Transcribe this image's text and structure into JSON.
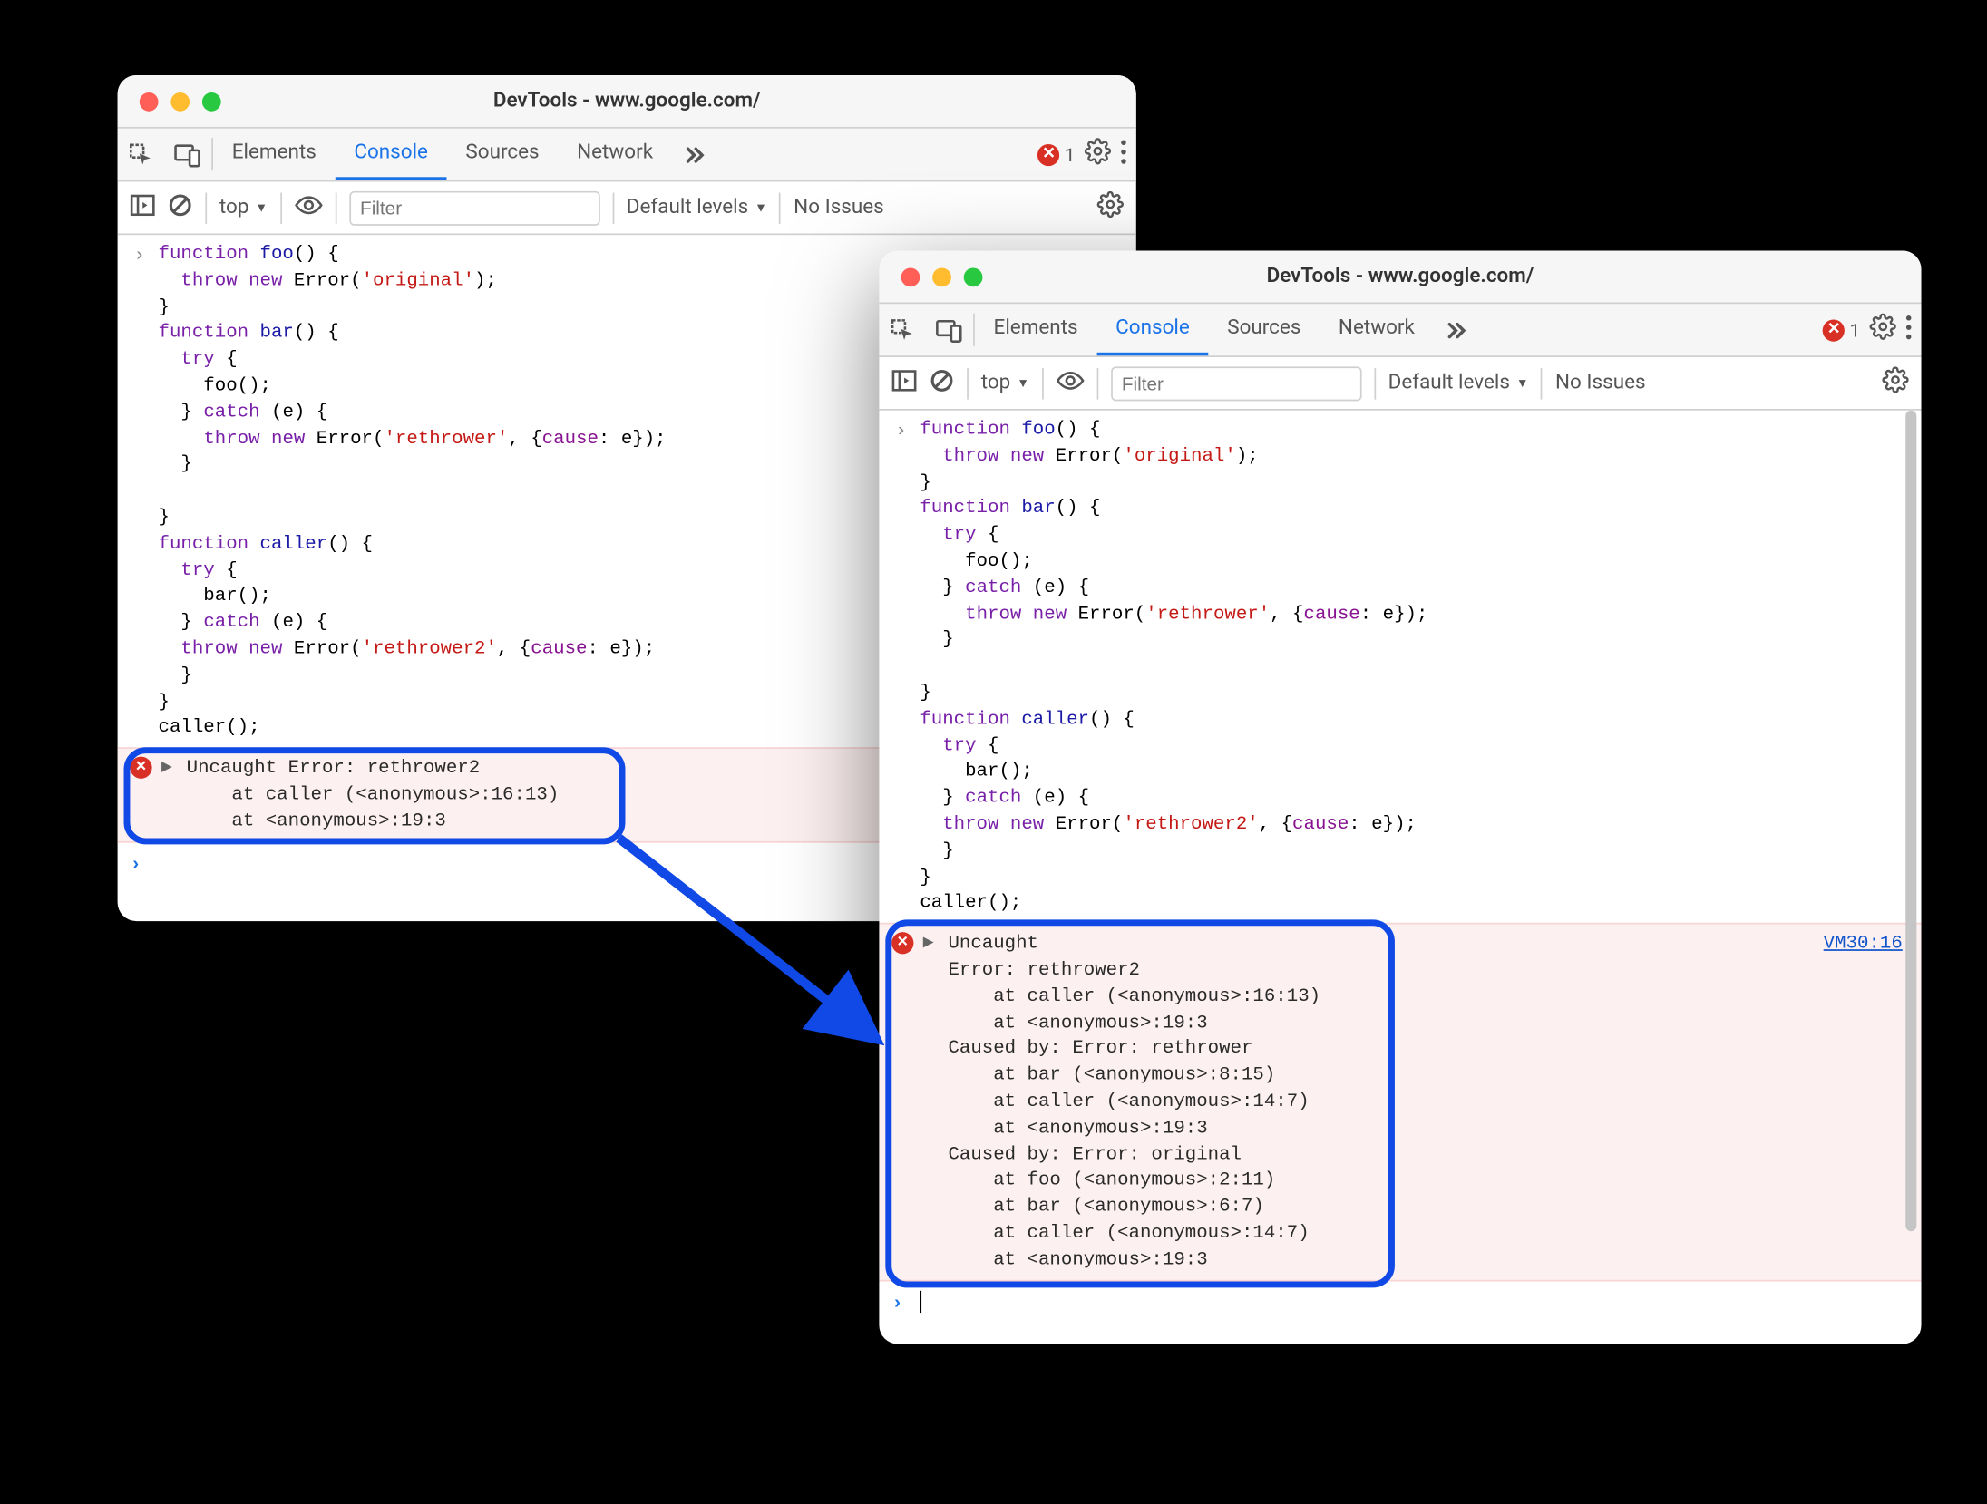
{
  "window": {
    "title": "DevTools - www.google.com/"
  },
  "tabs": {
    "elements": "Elements",
    "console": "Console",
    "sources": "Sources",
    "network": "Network"
  },
  "tabbar": {
    "error_count": "1"
  },
  "toolbar": {
    "context": "top",
    "filter_placeholder": "Filter",
    "levels": "Default levels",
    "issues": "No Issues"
  },
  "code": {
    "line1a": "function",
    "line1b": " ",
    "line1c": "foo",
    "line1d": "() {",
    "line2a": "  ",
    "line2b": "throw",
    "line2c": " ",
    "line2d": "new",
    "line2e": " Error(",
    "line2f": "'original'",
    "line2g": ");",
    "line3": "}",
    "line4a": "function",
    "line4b": " ",
    "line4c": "bar",
    "line4d": "() {",
    "line5a": "  ",
    "line5b": "try",
    "line5c": " {",
    "line6": "    foo();",
    "line7a": "  } ",
    "line7b": "catch",
    "line7c": " (e) {",
    "line8a": "    ",
    "line8b": "throw",
    "line8c": " ",
    "line8d": "new",
    "line8e": " Error(",
    "line8f": "'rethrower'",
    "line8g": ", {",
    "line8h": "cause",
    "line8i": ": e});",
    "line9": "  }",
    "line10": "",
    "line11": "}",
    "line12a": "function",
    "line12b": " ",
    "line12c": "caller",
    "line12d": "() {",
    "line13a": "  ",
    "line13b": "try",
    "line13c": " {",
    "line14": "    bar();",
    "line15a": "  } ",
    "line15b": "catch",
    "line15c": " (e) {",
    "line16a": "  ",
    "line16b": "throw",
    "line16c": " ",
    "line16d": "new",
    "line16e": " Error(",
    "line16f": "'rethrower2'",
    "line16g": ", {",
    "line16h": "cause",
    "line16i": ": e});",
    "line17": "  }",
    "line18": "}",
    "line19": "caller();"
  },
  "error1": {
    "text": "Uncaught Error: rethrower2\n    at caller (<anonymous>:16:13)\n    at <anonymous>:19:3"
  },
  "error2": {
    "head": "Uncaught",
    "link": "VM30:16",
    "body": "Error: rethrower2\n    at caller (<anonymous>:16:13)\n    at <anonymous>:19:3\nCaused by: Error: rethrower\n    at bar (<anonymous>:8:15)\n    at caller (<anonymous>:14:7)\n    at <anonymous>:19:3\nCaused by: Error: original\n    at foo (<anonymous>:2:11)\n    at bar (<anonymous>:6:7)\n    at caller (<anonymous>:14:7)\n    at <anonymous>:19:3"
  }
}
